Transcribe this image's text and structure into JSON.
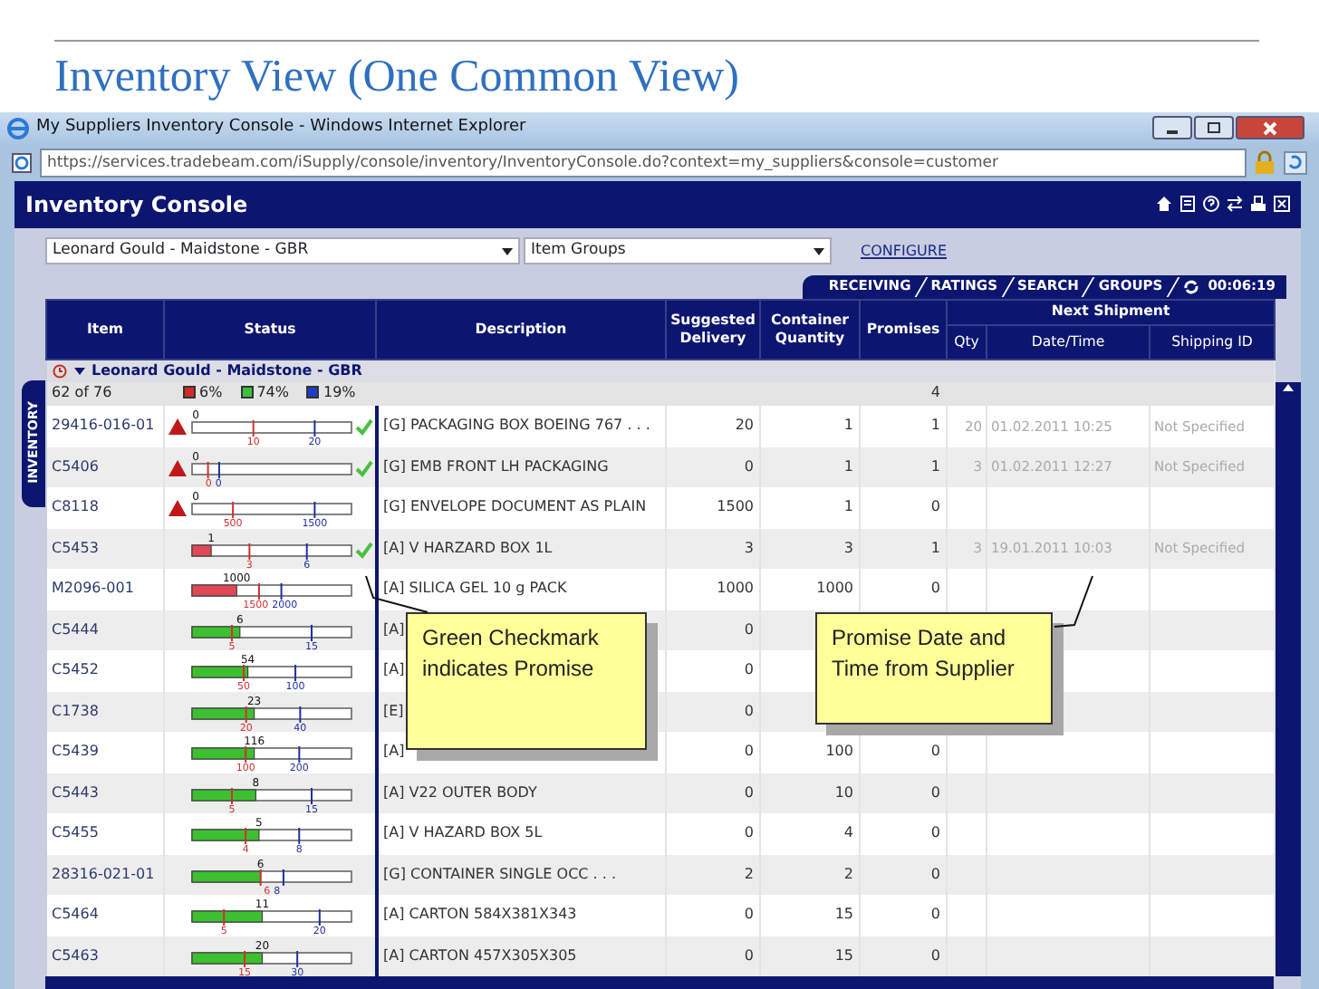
{
  "slide": {
    "title": "Inventory View (One Common View)"
  },
  "browser": {
    "title": "My Suppliers Inventory Console - Windows Internet Explorer",
    "url": "https://services.tradebeam.com/iSupply/console/inventory/InventoryConsole.do?context=my_suppliers&console=customer"
  },
  "console": {
    "title": "Inventory Console",
    "supplier_select": "Leonard Gould - Maidstone - GBR",
    "group_select": "Item Groups",
    "configure_link": "CONFIGURE",
    "tabs": [
      {
        "label": "RECEIVING"
      },
      {
        "label": "RATINGS"
      },
      {
        "label": "SEARCH"
      },
      {
        "label": "GROUPS"
      }
    ],
    "timer": "00:06:19",
    "side_tab": "INVENTORY"
  },
  "table": {
    "columns": [
      "Item",
      "Status",
      "Description",
      "Suggested Delivery",
      "Container Quantity",
      "Promises"
    ],
    "next_shipment": {
      "title": "Next Shipment",
      "columns": [
        "Qty",
        "Date/Time",
        "Shipping ID"
      ]
    },
    "group": {
      "label": "Leonard Gould - Maidstone - GBR",
      "expanded": true
    },
    "summary": {
      "count": "62 of 76",
      "promises": "4",
      "legend": [
        {
          "label": "6%",
          "color": "#d42a2a"
        },
        {
          "label": "74%",
          "color": "#3cc03c"
        },
        {
          "label": "19%",
          "color": "#1c3cc8"
        }
      ]
    },
    "rows": [
      {
        "item": "29416-016-01",
        "alert": true,
        "stock": "0",
        "min": "10",
        "max": "20",
        "promised": true,
        "description": "[G] PACKAGING BOX BOEING 767 . . .",
        "suggested": "20",
        "container_qty": "1",
        "promises": "1",
        "ship_qty": "20",
        "ship_date": "01.02.2011 10:25",
        "shipping_id": "Not Specified"
      },
      {
        "item": "C5406",
        "alert": true,
        "stock": "0",
        "min": "0",
        "max": "0",
        "promised": true,
        "description": "[G] EMB FRONT LH PACKAGING",
        "suggested": "0",
        "container_qty": "1",
        "promises": "1",
        "ship_qty": "3",
        "ship_date": "01.02.2011 12:27",
        "shipping_id": "Not Specified"
      },
      {
        "item": "C8118",
        "alert": true,
        "stock": "0",
        "min": "500",
        "max": "1500",
        "promised": false,
        "description": "[G] ENVELOPE DOCUMENT AS PLAIN",
        "suggested": "1500",
        "container_qty": "1",
        "promises": "0"
      },
      {
        "item": "C5453",
        "alert": false,
        "stock": "1",
        "level": 0.12,
        "below_min": true,
        "min": "3",
        "max": "6",
        "promised": true,
        "description": "[A] V HARZARD BOX 1L",
        "suggested": "3",
        "container_qty": "3",
        "promises": "1",
        "ship_qty": "3",
        "ship_date": "19.01.2011 10:03",
        "shipping_id": "Not Specified"
      },
      {
        "item": "M2096-001",
        "alert": false,
        "stock": "1000",
        "level": 0.28,
        "below_min": true,
        "min": "1500",
        "max": "2000",
        "promised": false,
        "description": "[A] SILICA GEL 10 g PACK",
        "suggested": "1000",
        "container_qty": "1000",
        "promises": "0"
      },
      {
        "item": "C5444",
        "alert": false,
        "stock": "6",
        "level": 0.3,
        "below_min": false,
        "min": "5",
        "max": "15",
        "promised": false,
        "description": "[A]",
        "suggested": "0"
      },
      {
        "item": "C5452",
        "alert": false,
        "stock": "54",
        "level": 0.35,
        "below_min": false,
        "min": "50",
        "max": "100",
        "promised": false,
        "description": "[A]",
        "suggested": "0"
      },
      {
        "item": "C1738",
        "alert": false,
        "stock": "23",
        "level": 0.39,
        "below_min": false,
        "min": "20",
        "max": "40",
        "promised": false,
        "description": "[E]",
        "suggested": "0"
      },
      {
        "item": "C5439",
        "alert": false,
        "stock": "116",
        "level": 0.39,
        "below_min": false,
        "min": "100",
        "max": "200",
        "promised": false,
        "description": "[A]",
        "suggested": "0",
        "container_qty": "100",
        "promises": "0"
      },
      {
        "item": "C5443",
        "alert": false,
        "stock": "8",
        "level": 0.4,
        "below_min": false,
        "min": "5",
        "max": "15",
        "promised": false,
        "description": "[A] V22 OUTER BODY",
        "suggested": "0",
        "container_qty": "10",
        "promises": "0"
      },
      {
        "item": "C5455",
        "alert": false,
        "stock": "5",
        "level": 0.42,
        "below_min": false,
        "min": "4",
        "max": "8",
        "promised": false,
        "description": "[A] V HAZARD BOX 5L",
        "suggested": "0",
        "container_qty": "4",
        "promises": "0"
      },
      {
        "item": "28316-021-01",
        "alert": false,
        "stock": "6",
        "level": 0.43,
        "below_min": false,
        "min": "6",
        "max": "8",
        "promised": false,
        "description": "[G] CONTAINER SINGLE OCC . . .",
        "suggested": "2",
        "container_qty": "2",
        "promises": "0"
      },
      {
        "item": "C5464",
        "alert": false,
        "stock": "11",
        "level": 0.44,
        "below_min": false,
        "min": "5",
        "max": "20",
        "promised": false,
        "description": "[A] CARTON 584X381X343",
        "suggested": "0",
        "container_qty": "15",
        "promises": "0"
      },
      {
        "item": "C5463",
        "alert": false,
        "stock": "20",
        "level": 0.44,
        "below_min": false,
        "min": "15",
        "max": "30",
        "promised": false,
        "description": "[A] CARTON 457X305X305",
        "suggested": "0",
        "container_qty": "15",
        "promises": "0"
      }
    ]
  },
  "callouts": [
    {
      "text": "Green Checkmark indicates Promise"
    },
    {
      "text": "Promise Date and Time from Supplier"
    }
  ]
}
